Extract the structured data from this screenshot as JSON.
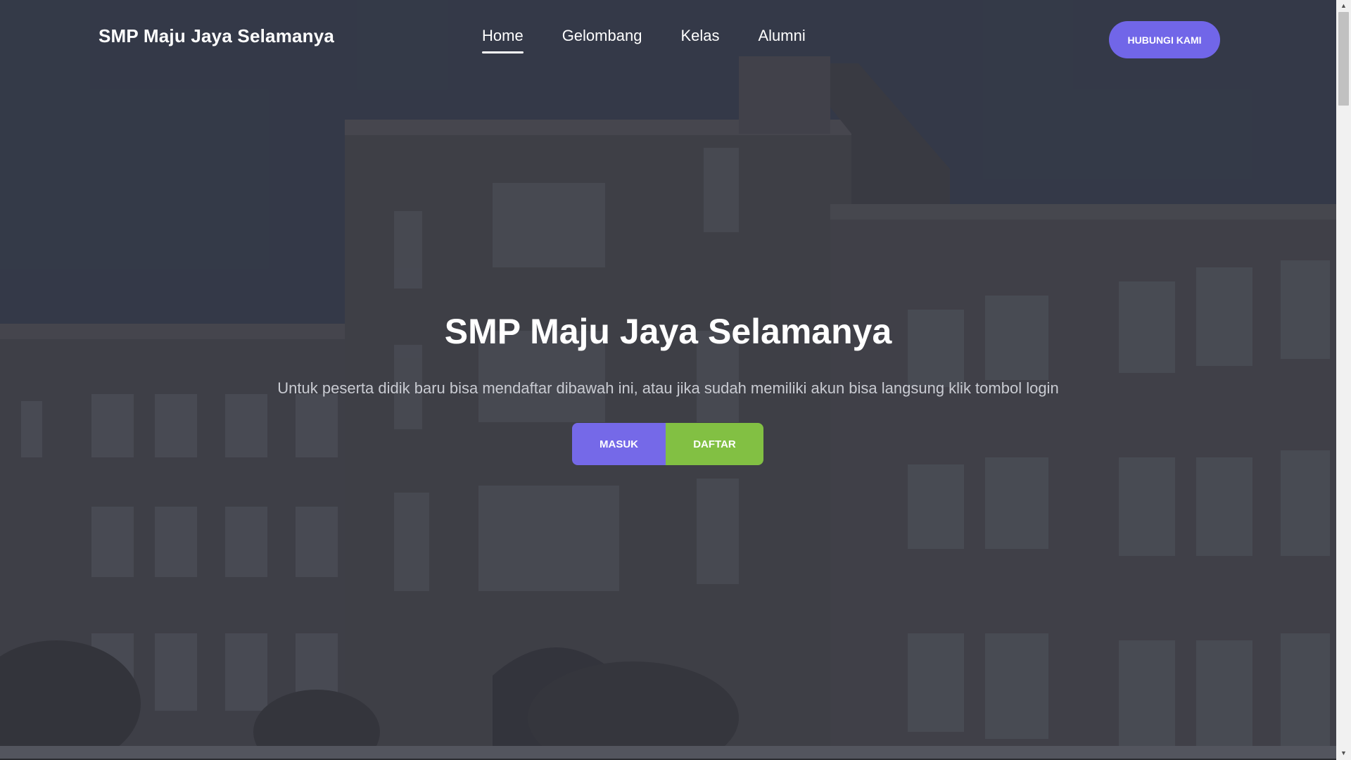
{
  "navbar": {
    "brand": "SMP Maju Jaya Selamanya",
    "links": [
      {
        "label": "Home",
        "active": true
      },
      {
        "label": "Gelombang",
        "active": false
      },
      {
        "label": "Kelas",
        "active": false
      },
      {
        "label": "Alumni",
        "active": false
      }
    ],
    "cta_label": "HUBUNGI KAMI"
  },
  "hero": {
    "title": "SMP Maju Jaya Selamanya",
    "subtitle": "Untuk peserta didik baru bisa mendaftar dibawah ini, atau jika sudah memiliki akun bisa langsung klik tombol login",
    "masuk_label": "MASUK",
    "daftar_label": "DAFTAR"
  },
  "scrollbar": {
    "up_icon": "▲",
    "down_icon": "▼"
  },
  "colors": {
    "accent_purple": "#7166e8",
    "accent_green": "#82c043",
    "overlay": "#3e4250"
  }
}
